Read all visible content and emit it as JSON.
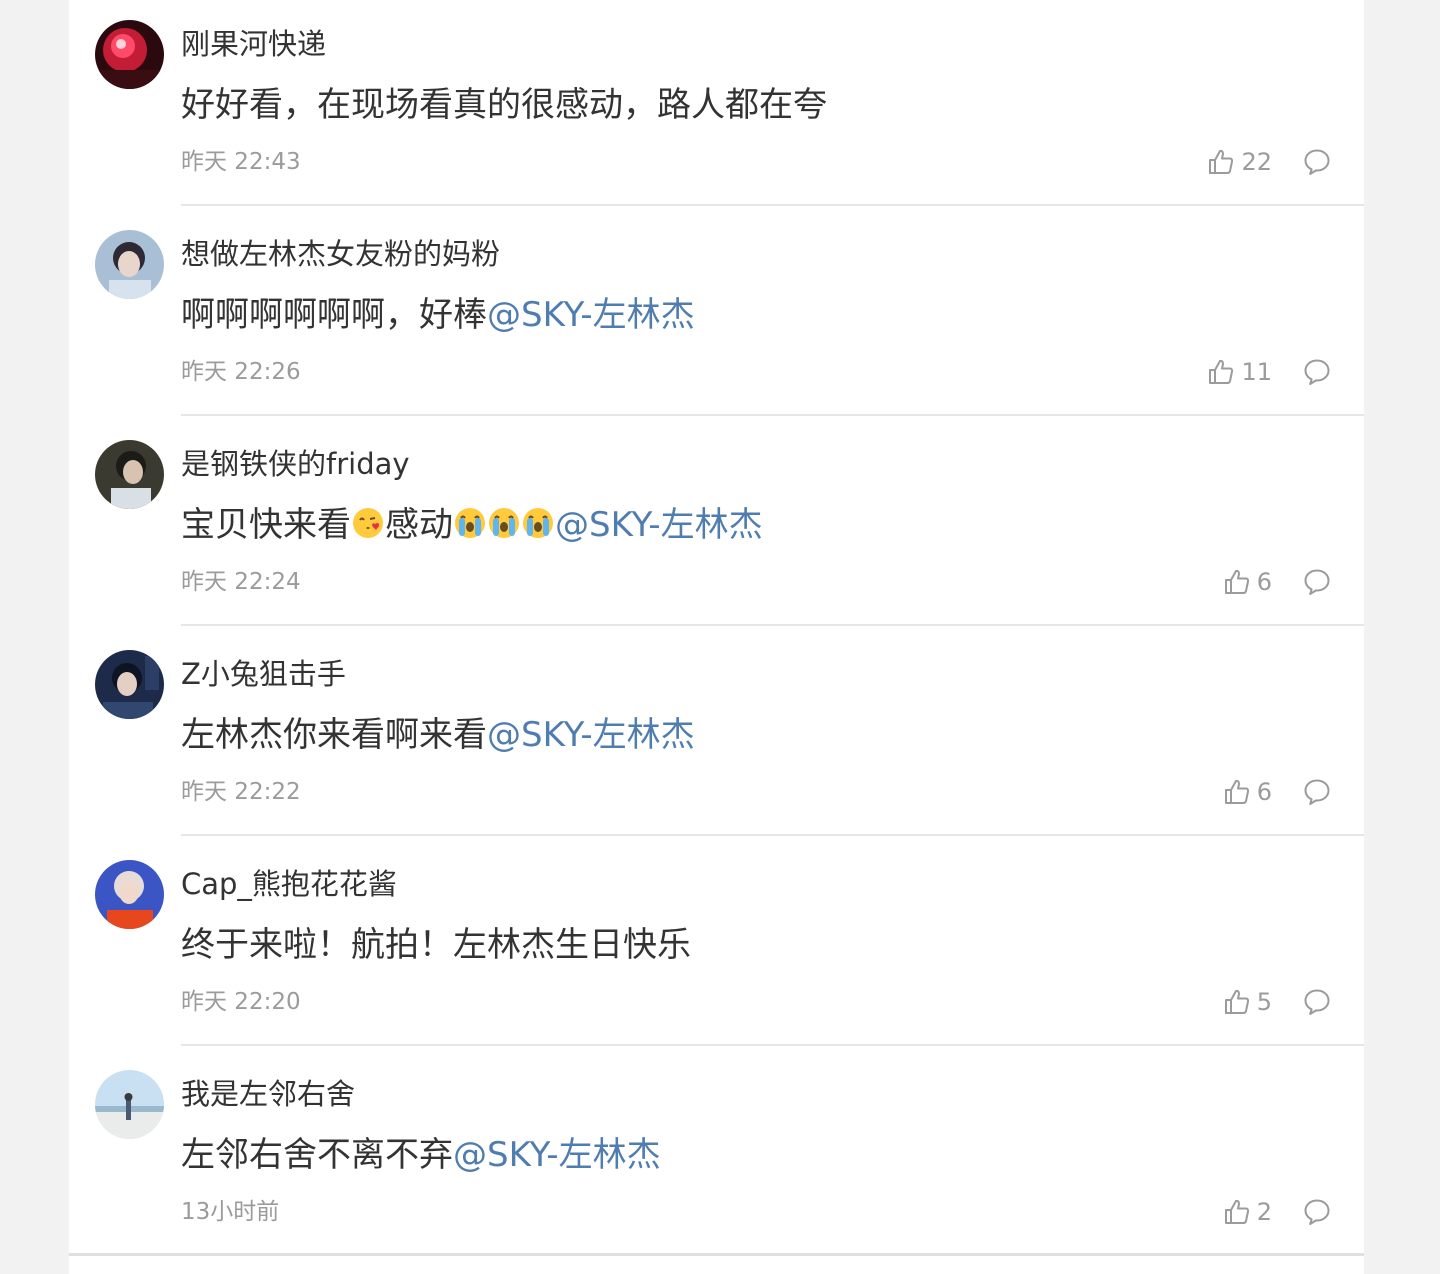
{
  "comments": [
    {
      "username": "刚果河快递",
      "text": "好好看，在现场看真的很感动，路人都在夸",
      "time": "昨天 22:43",
      "likes": "22"
    },
    {
      "username": "想做左林杰女友粉的妈粉",
      "text": "啊啊啊啊啊啊，好棒",
      "mention": "@SKY-左林杰",
      "time": "昨天 22:26",
      "likes": "11"
    },
    {
      "username": "是钢铁侠的friday",
      "text_before": "宝贝快来看",
      "text_middle": "感动",
      "mention": "@SKY-左林杰",
      "time": "昨天 22:24",
      "likes": "6"
    },
    {
      "username": "Z小兔狙击手",
      "text": "左林杰你来看啊来看",
      "mention": "@SKY-左林杰",
      "time": "昨天 22:22",
      "likes": "6"
    },
    {
      "username": "Cap_熊抱花花酱",
      "text": "终于来啦！航拍！左林杰生日快乐",
      "time": "昨天 22:20",
      "likes": "5"
    },
    {
      "username": "我是左邻右舍",
      "text": "左邻右舍不离不弃",
      "mention": "@SKY-左林杰",
      "time": "13小时前",
      "likes": "2"
    }
  ],
  "icons": {
    "like": "thumbs-up-icon",
    "reply": "speech-bubble-icon",
    "emoji_love": "face-blowing-kiss-emoji",
    "emoji_cry": "loudly-crying-face-emoji"
  },
  "colors": {
    "mention": "#507daf",
    "text": "#333333",
    "meta": "#9b9b9b"
  }
}
